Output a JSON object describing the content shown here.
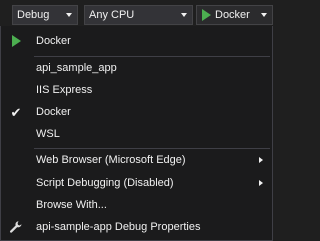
{
  "toolbar": {
    "configuration": "Debug",
    "platform": "Any CPU",
    "run_target": "Docker"
  },
  "menu": {
    "run_item": "Docker",
    "profiles": [
      "api_sample_app",
      "IIS Express",
      "Docker",
      "WSL"
    ],
    "checked_profile": "Docker",
    "web_browser": "Web Browser (Microsoft Edge)",
    "script_debugging": "Script Debugging (Disabled)",
    "browse_with": "Browse With...",
    "debug_properties": "api-sample-app Debug Properties"
  },
  "colors": {
    "play": "#4caf50",
    "menu_bg": "#1b1b1c",
    "toolbar_bg": "#1f1f1f"
  }
}
